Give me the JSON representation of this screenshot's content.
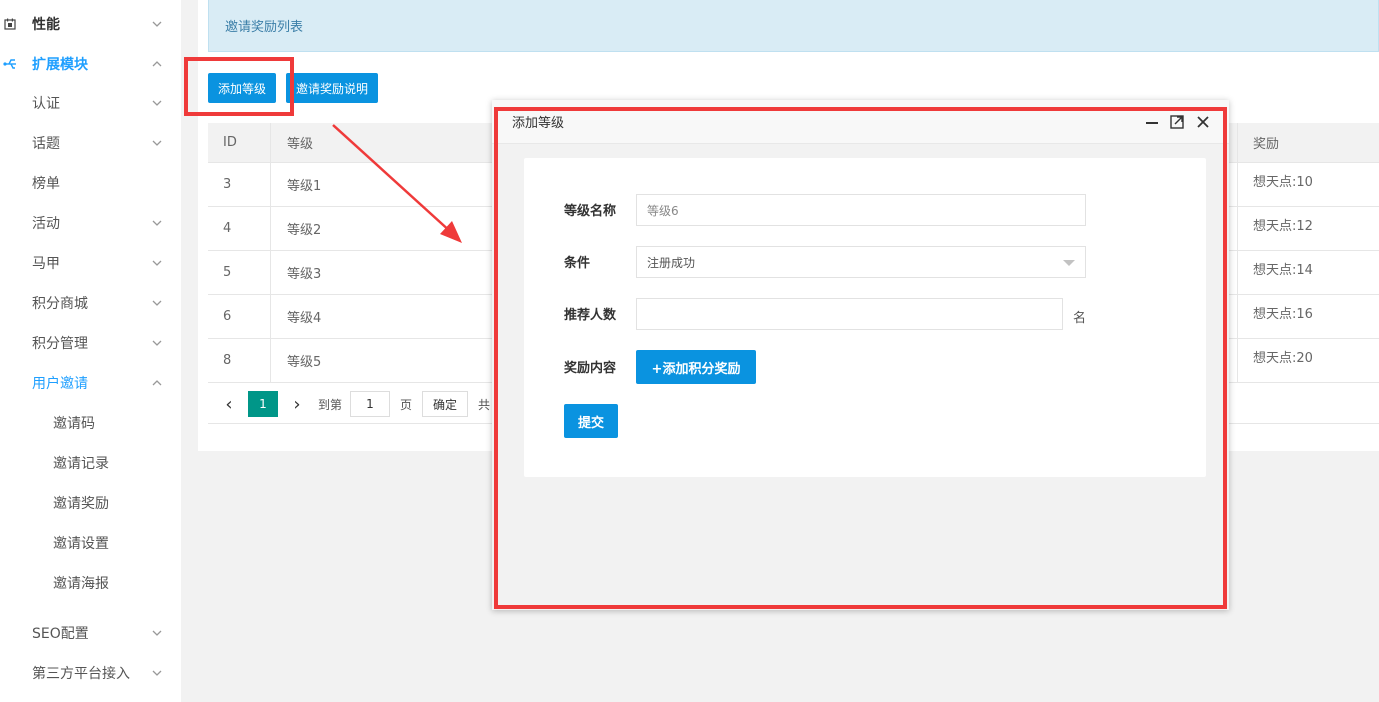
{
  "sidebar": {
    "items": [
      {
        "label": "性能",
        "icon": "calendar-icon"
      },
      {
        "label": "扩展模块",
        "icon": "extension-icon"
      },
      {
        "label": "认证"
      },
      {
        "label": "话题"
      },
      {
        "label": "榜单"
      },
      {
        "label": "活动"
      },
      {
        "label": "马甲"
      },
      {
        "label": "积分商城"
      },
      {
        "label": "积分管理"
      },
      {
        "label": "用户邀请"
      },
      {
        "label": "邀请码"
      },
      {
        "label": "邀请记录"
      },
      {
        "label": "邀请奖励"
      },
      {
        "label": "邀请设置"
      },
      {
        "label": "邀请海报"
      },
      {
        "label": "SEO配置"
      },
      {
        "label": "第三方平台接入"
      }
    ]
  },
  "main": {
    "notice": "邀请奖励列表",
    "add_level_button": "添加等级",
    "reward_desc_button": "邀请奖励说明",
    "table": {
      "headers": [
        "ID",
        "等级",
        "奖励"
      ],
      "rows": [
        {
          "id": "3",
          "level": "等级1",
          "reward": "想天点:10"
        },
        {
          "id": "4",
          "level": "等级2",
          "reward": "想天点:12"
        },
        {
          "id": "5",
          "level": "等级3",
          "reward": "想天点:14"
        },
        {
          "id": "6",
          "level": "等级4",
          "reward": "想天点:16"
        },
        {
          "id": "8",
          "level": "等级5",
          "reward": "想天点:20"
        }
      ]
    },
    "pager": {
      "prev": "‹",
      "current": "1",
      "next": "›",
      "goto_label": "到第",
      "page_value": "1",
      "page_unit": "页",
      "confirm": "确定",
      "total_prefix": "共"
    }
  },
  "modal": {
    "title": "添加等级",
    "name_label": "等级名称",
    "name_placeholder": "等级6",
    "condition_label": "条件",
    "condition_value": "注册成功",
    "referrals_label": "推荐人数",
    "referrals_value": "",
    "referrals_unit": "名",
    "reward_label": "奖励内容",
    "add_reward_button": "+添加积分奖励",
    "submit_button": "提交"
  },
  "colors": {
    "accent": "#0a93e0",
    "highlight": "#ef3a3a",
    "page_active": "#009688"
  }
}
